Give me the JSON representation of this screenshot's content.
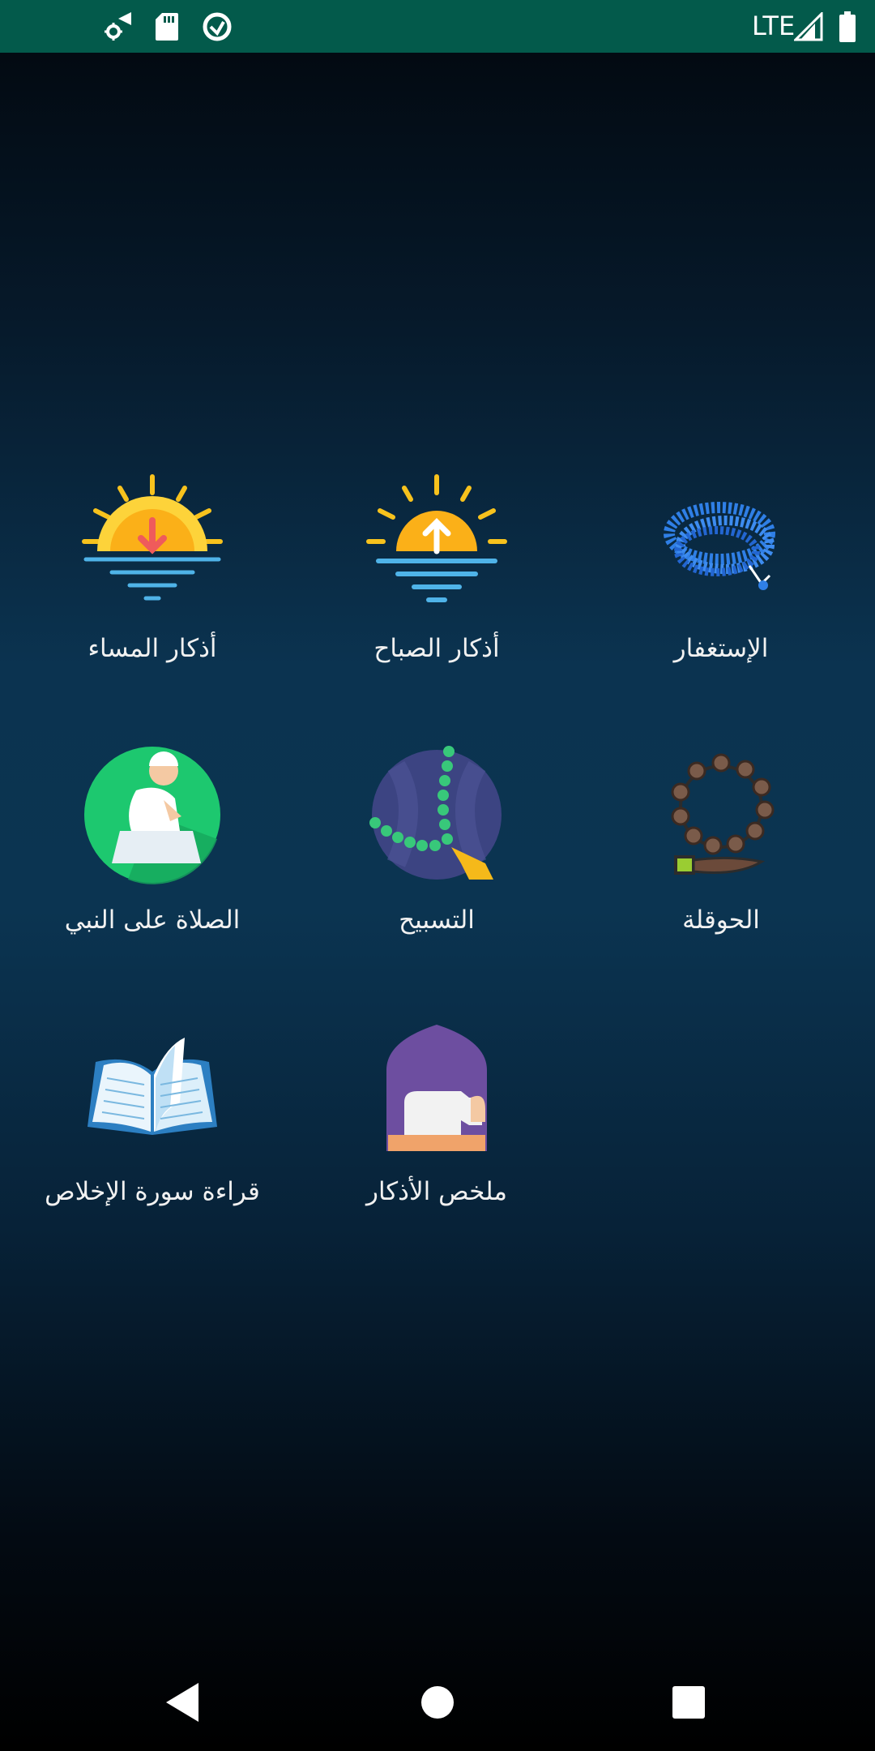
{
  "status_bar": {
    "network": "LTE",
    "color": "#035a4b",
    "left_icons": [
      "settings-sync-icon",
      "sd-card-icon",
      "data-saver-icon"
    ],
    "right_icons": [
      "signal-icon",
      "battery-icon"
    ]
  },
  "menu": {
    "items": [
      {
        "label": "الإستغفار",
        "icon": "prayer-beads-blue-icon"
      },
      {
        "label": "أذكار الصباح",
        "icon": "sunrise-icon"
      },
      {
        "label": "أذكار المساء",
        "icon": "sunset-icon"
      },
      {
        "label": "الحوقلة",
        "icon": "prayer-beads-brown-icon"
      },
      {
        "label": "التسبيح",
        "icon": "tasbih-green-icon"
      },
      {
        "label": "الصلاة على النبي",
        "icon": "praying-man-icon"
      },
      {
        "label": "ملخص الأذكار",
        "icon": "prostration-mosque-icon"
      },
      {
        "label": "قراءة سورة الإخلاص",
        "icon": "open-quran-icon"
      }
    ]
  },
  "nav_bar": {
    "buttons": [
      "back-icon",
      "home-icon",
      "recents-icon"
    ]
  }
}
